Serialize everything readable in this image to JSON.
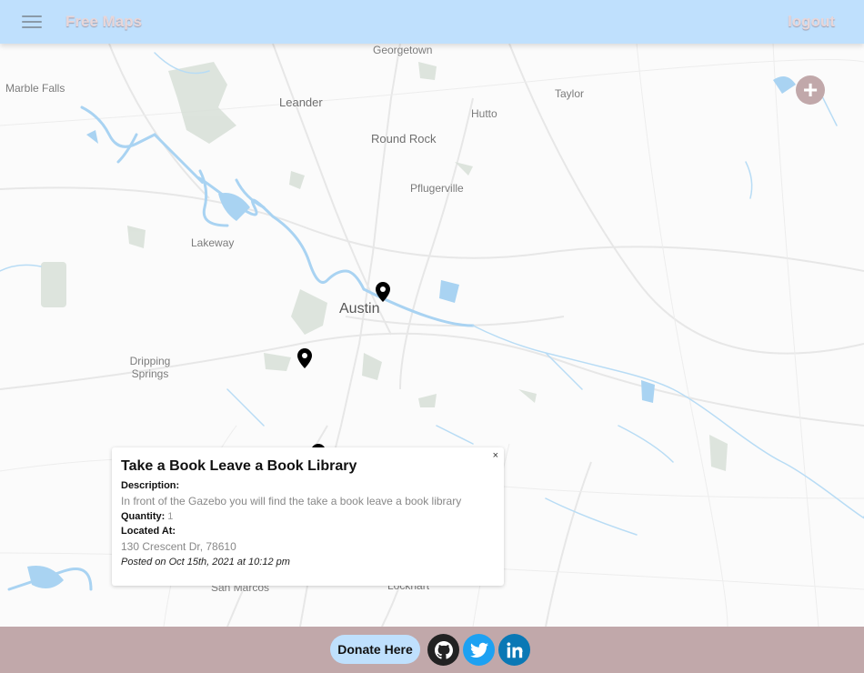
{
  "header": {
    "brand": "Free Maps",
    "logout": "logout"
  },
  "map": {
    "places": [
      {
        "name": "Georgetown"
      },
      {
        "name": "Marble Falls"
      },
      {
        "name": "Leander"
      },
      {
        "name": "Taylor"
      },
      {
        "name": "Hutto"
      },
      {
        "name": "Round Rock"
      },
      {
        "name": "Pflugerville"
      },
      {
        "name": "Lakeway"
      },
      {
        "name": "Austin"
      },
      {
        "name": "Dripping Springs"
      },
      {
        "name": "San Marcos"
      },
      {
        "name": "Lockhart"
      }
    ],
    "add_button": "+"
  },
  "popup": {
    "close": "×",
    "title": "Take a Book Leave a Book Library",
    "description_label": "Description:",
    "description": "In front of the Gazebo you will find the take a book leave a book library",
    "quantity_label": "Quantity:",
    "quantity": "1",
    "located_label": "Located At:",
    "address": "130 Crescent Dr, 78610",
    "posted": "Posted on Oct 15th, 2021 at 10:12 pm"
  },
  "footer": {
    "donate": "Donate Here",
    "icons": [
      "github-icon",
      "twitter-icon",
      "linkedin-icon"
    ],
    "colors": {
      "github": "#222222",
      "twitter": "#1da1f2",
      "linkedin": "#0a78b5"
    }
  },
  "colors": {
    "header": "#bfe0fd",
    "footer": "#c1a8aa",
    "water": "#a9d3f2",
    "park": "#d6ddd6"
  }
}
